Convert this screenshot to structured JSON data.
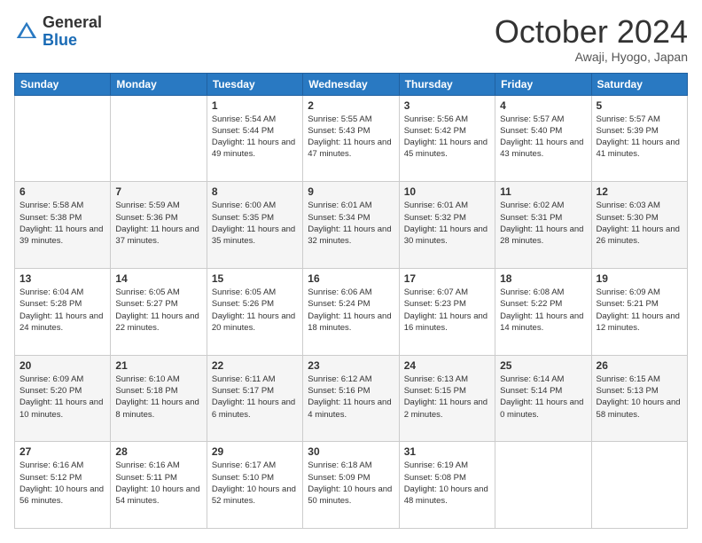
{
  "logo": {
    "general": "General",
    "blue": "Blue"
  },
  "title": "October 2024",
  "subtitle": "Awaji, Hyogo, Japan",
  "days_header": [
    "Sunday",
    "Monday",
    "Tuesday",
    "Wednesday",
    "Thursday",
    "Friday",
    "Saturday"
  ],
  "weeks": [
    [
      {
        "day": "",
        "sunrise": "",
        "sunset": "",
        "daylight": ""
      },
      {
        "day": "",
        "sunrise": "",
        "sunset": "",
        "daylight": ""
      },
      {
        "day": "1",
        "sunrise": "Sunrise: 5:54 AM",
        "sunset": "Sunset: 5:44 PM",
        "daylight": "Daylight: 11 hours and 49 minutes."
      },
      {
        "day": "2",
        "sunrise": "Sunrise: 5:55 AM",
        "sunset": "Sunset: 5:43 PM",
        "daylight": "Daylight: 11 hours and 47 minutes."
      },
      {
        "day": "3",
        "sunrise": "Sunrise: 5:56 AM",
        "sunset": "Sunset: 5:42 PM",
        "daylight": "Daylight: 11 hours and 45 minutes."
      },
      {
        "day": "4",
        "sunrise": "Sunrise: 5:57 AM",
        "sunset": "Sunset: 5:40 PM",
        "daylight": "Daylight: 11 hours and 43 minutes."
      },
      {
        "day": "5",
        "sunrise": "Sunrise: 5:57 AM",
        "sunset": "Sunset: 5:39 PM",
        "daylight": "Daylight: 11 hours and 41 minutes."
      }
    ],
    [
      {
        "day": "6",
        "sunrise": "Sunrise: 5:58 AM",
        "sunset": "Sunset: 5:38 PM",
        "daylight": "Daylight: 11 hours and 39 minutes."
      },
      {
        "day": "7",
        "sunrise": "Sunrise: 5:59 AM",
        "sunset": "Sunset: 5:36 PM",
        "daylight": "Daylight: 11 hours and 37 minutes."
      },
      {
        "day": "8",
        "sunrise": "Sunrise: 6:00 AM",
        "sunset": "Sunset: 5:35 PM",
        "daylight": "Daylight: 11 hours and 35 minutes."
      },
      {
        "day": "9",
        "sunrise": "Sunrise: 6:01 AM",
        "sunset": "Sunset: 5:34 PM",
        "daylight": "Daylight: 11 hours and 32 minutes."
      },
      {
        "day": "10",
        "sunrise": "Sunrise: 6:01 AM",
        "sunset": "Sunset: 5:32 PM",
        "daylight": "Daylight: 11 hours and 30 minutes."
      },
      {
        "day": "11",
        "sunrise": "Sunrise: 6:02 AM",
        "sunset": "Sunset: 5:31 PM",
        "daylight": "Daylight: 11 hours and 28 minutes."
      },
      {
        "day": "12",
        "sunrise": "Sunrise: 6:03 AM",
        "sunset": "Sunset: 5:30 PM",
        "daylight": "Daylight: 11 hours and 26 minutes."
      }
    ],
    [
      {
        "day": "13",
        "sunrise": "Sunrise: 6:04 AM",
        "sunset": "Sunset: 5:28 PM",
        "daylight": "Daylight: 11 hours and 24 minutes."
      },
      {
        "day": "14",
        "sunrise": "Sunrise: 6:05 AM",
        "sunset": "Sunset: 5:27 PM",
        "daylight": "Daylight: 11 hours and 22 minutes."
      },
      {
        "day": "15",
        "sunrise": "Sunrise: 6:05 AM",
        "sunset": "Sunset: 5:26 PM",
        "daylight": "Daylight: 11 hours and 20 minutes."
      },
      {
        "day": "16",
        "sunrise": "Sunrise: 6:06 AM",
        "sunset": "Sunset: 5:24 PM",
        "daylight": "Daylight: 11 hours and 18 minutes."
      },
      {
        "day": "17",
        "sunrise": "Sunrise: 6:07 AM",
        "sunset": "Sunset: 5:23 PM",
        "daylight": "Daylight: 11 hours and 16 minutes."
      },
      {
        "day": "18",
        "sunrise": "Sunrise: 6:08 AM",
        "sunset": "Sunset: 5:22 PM",
        "daylight": "Daylight: 11 hours and 14 minutes."
      },
      {
        "day": "19",
        "sunrise": "Sunrise: 6:09 AM",
        "sunset": "Sunset: 5:21 PM",
        "daylight": "Daylight: 11 hours and 12 minutes."
      }
    ],
    [
      {
        "day": "20",
        "sunrise": "Sunrise: 6:09 AM",
        "sunset": "Sunset: 5:20 PM",
        "daylight": "Daylight: 11 hours and 10 minutes."
      },
      {
        "day": "21",
        "sunrise": "Sunrise: 6:10 AM",
        "sunset": "Sunset: 5:18 PM",
        "daylight": "Daylight: 11 hours and 8 minutes."
      },
      {
        "day": "22",
        "sunrise": "Sunrise: 6:11 AM",
        "sunset": "Sunset: 5:17 PM",
        "daylight": "Daylight: 11 hours and 6 minutes."
      },
      {
        "day": "23",
        "sunrise": "Sunrise: 6:12 AM",
        "sunset": "Sunset: 5:16 PM",
        "daylight": "Daylight: 11 hours and 4 minutes."
      },
      {
        "day": "24",
        "sunrise": "Sunrise: 6:13 AM",
        "sunset": "Sunset: 5:15 PM",
        "daylight": "Daylight: 11 hours and 2 minutes."
      },
      {
        "day": "25",
        "sunrise": "Sunrise: 6:14 AM",
        "sunset": "Sunset: 5:14 PM",
        "daylight": "Daylight: 11 hours and 0 minutes."
      },
      {
        "day": "26",
        "sunrise": "Sunrise: 6:15 AM",
        "sunset": "Sunset: 5:13 PM",
        "daylight": "Daylight: 10 hours and 58 minutes."
      }
    ],
    [
      {
        "day": "27",
        "sunrise": "Sunrise: 6:16 AM",
        "sunset": "Sunset: 5:12 PM",
        "daylight": "Daylight: 10 hours and 56 minutes."
      },
      {
        "day": "28",
        "sunrise": "Sunrise: 6:16 AM",
        "sunset": "Sunset: 5:11 PM",
        "daylight": "Daylight: 10 hours and 54 minutes."
      },
      {
        "day": "29",
        "sunrise": "Sunrise: 6:17 AM",
        "sunset": "Sunset: 5:10 PM",
        "daylight": "Daylight: 10 hours and 52 minutes."
      },
      {
        "day": "30",
        "sunrise": "Sunrise: 6:18 AM",
        "sunset": "Sunset: 5:09 PM",
        "daylight": "Daylight: 10 hours and 50 minutes."
      },
      {
        "day": "31",
        "sunrise": "Sunrise: 6:19 AM",
        "sunset": "Sunset: 5:08 PM",
        "daylight": "Daylight: 10 hours and 48 minutes."
      },
      {
        "day": "",
        "sunrise": "",
        "sunset": "",
        "daylight": ""
      },
      {
        "day": "",
        "sunrise": "",
        "sunset": "",
        "daylight": ""
      }
    ]
  ]
}
